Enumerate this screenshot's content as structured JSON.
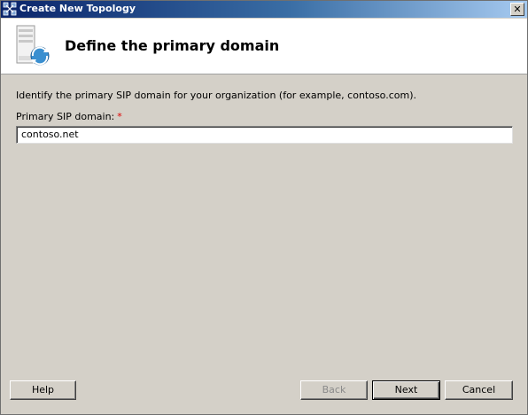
{
  "window": {
    "title": "Create New Topology",
    "close_label": "✕"
  },
  "header": {
    "title": "Define the primary domain"
  },
  "content": {
    "instruction": "Identify the primary SIP domain for your organization (for example, contoso.com).",
    "field_label": "Primary SIP domain:",
    "required_mark": "*",
    "field_value": "contoso.net"
  },
  "buttons": {
    "help": "Help",
    "back": "Back",
    "next": "Next",
    "cancel": "Cancel"
  },
  "icons": {
    "title_icon": "topology-icon",
    "header_icon": "server-globe-icon"
  },
  "colors": {
    "titlebar_start": "#0a246a",
    "titlebar_end": "#a6caf0",
    "dialog_bg": "#d4d0c8",
    "required": "#e00000"
  }
}
